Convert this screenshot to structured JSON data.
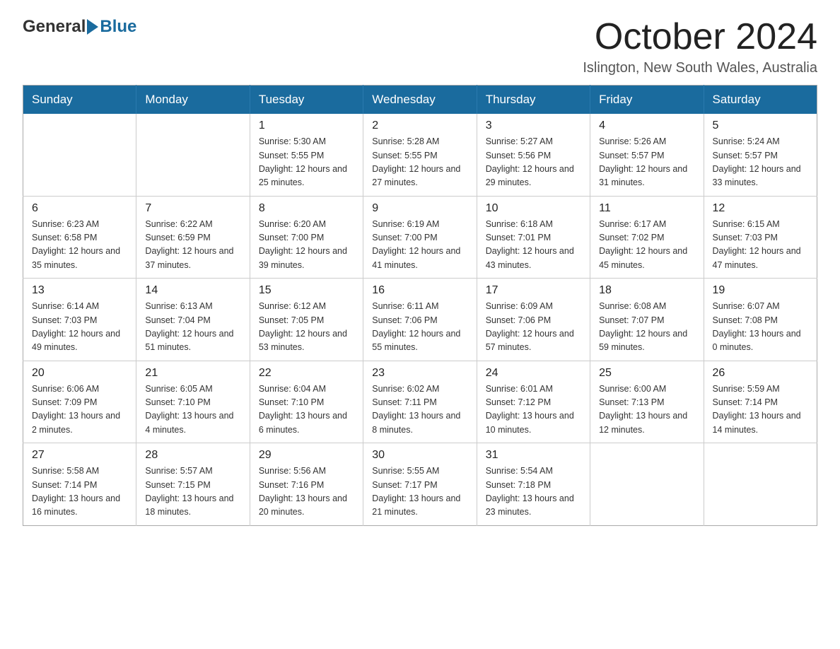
{
  "header": {
    "month_title": "October 2024",
    "location": "Islington, New South Wales, Australia",
    "logo_general": "General",
    "logo_blue": "Blue"
  },
  "calendar": {
    "days_of_week": [
      "Sunday",
      "Monday",
      "Tuesday",
      "Wednesday",
      "Thursday",
      "Friday",
      "Saturday"
    ],
    "weeks": [
      [
        {
          "day": "",
          "info": ""
        },
        {
          "day": "",
          "info": ""
        },
        {
          "day": "1",
          "info": "Sunrise: 5:30 AM\nSunset: 5:55 PM\nDaylight: 12 hours\nand 25 minutes."
        },
        {
          "day": "2",
          "info": "Sunrise: 5:28 AM\nSunset: 5:55 PM\nDaylight: 12 hours\nand 27 minutes."
        },
        {
          "day": "3",
          "info": "Sunrise: 5:27 AM\nSunset: 5:56 PM\nDaylight: 12 hours\nand 29 minutes."
        },
        {
          "day": "4",
          "info": "Sunrise: 5:26 AM\nSunset: 5:57 PM\nDaylight: 12 hours\nand 31 minutes."
        },
        {
          "day": "5",
          "info": "Sunrise: 5:24 AM\nSunset: 5:57 PM\nDaylight: 12 hours\nand 33 minutes."
        }
      ],
      [
        {
          "day": "6",
          "info": "Sunrise: 6:23 AM\nSunset: 6:58 PM\nDaylight: 12 hours\nand 35 minutes."
        },
        {
          "day": "7",
          "info": "Sunrise: 6:22 AM\nSunset: 6:59 PM\nDaylight: 12 hours\nand 37 minutes."
        },
        {
          "day": "8",
          "info": "Sunrise: 6:20 AM\nSunset: 7:00 PM\nDaylight: 12 hours\nand 39 minutes."
        },
        {
          "day": "9",
          "info": "Sunrise: 6:19 AM\nSunset: 7:00 PM\nDaylight: 12 hours\nand 41 minutes."
        },
        {
          "day": "10",
          "info": "Sunrise: 6:18 AM\nSunset: 7:01 PM\nDaylight: 12 hours\nand 43 minutes."
        },
        {
          "day": "11",
          "info": "Sunrise: 6:17 AM\nSunset: 7:02 PM\nDaylight: 12 hours\nand 45 minutes."
        },
        {
          "day": "12",
          "info": "Sunrise: 6:15 AM\nSunset: 7:03 PM\nDaylight: 12 hours\nand 47 minutes."
        }
      ],
      [
        {
          "day": "13",
          "info": "Sunrise: 6:14 AM\nSunset: 7:03 PM\nDaylight: 12 hours\nand 49 minutes."
        },
        {
          "day": "14",
          "info": "Sunrise: 6:13 AM\nSunset: 7:04 PM\nDaylight: 12 hours\nand 51 minutes."
        },
        {
          "day": "15",
          "info": "Sunrise: 6:12 AM\nSunset: 7:05 PM\nDaylight: 12 hours\nand 53 minutes."
        },
        {
          "day": "16",
          "info": "Sunrise: 6:11 AM\nSunset: 7:06 PM\nDaylight: 12 hours\nand 55 minutes."
        },
        {
          "day": "17",
          "info": "Sunrise: 6:09 AM\nSunset: 7:06 PM\nDaylight: 12 hours\nand 57 minutes."
        },
        {
          "day": "18",
          "info": "Sunrise: 6:08 AM\nSunset: 7:07 PM\nDaylight: 12 hours\nand 59 minutes."
        },
        {
          "day": "19",
          "info": "Sunrise: 6:07 AM\nSunset: 7:08 PM\nDaylight: 13 hours\nand 0 minutes."
        }
      ],
      [
        {
          "day": "20",
          "info": "Sunrise: 6:06 AM\nSunset: 7:09 PM\nDaylight: 13 hours\nand 2 minutes."
        },
        {
          "day": "21",
          "info": "Sunrise: 6:05 AM\nSunset: 7:10 PM\nDaylight: 13 hours\nand 4 minutes."
        },
        {
          "day": "22",
          "info": "Sunrise: 6:04 AM\nSunset: 7:10 PM\nDaylight: 13 hours\nand 6 minutes."
        },
        {
          "day": "23",
          "info": "Sunrise: 6:02 AM\nSunset: 7:11 PM\nDaylight: 13 hours\nand 8 minutes."
        },
        {
          "day": "24",
          "info": "Sunrise: 6:01 AM\nSunset: 7:12 PM\nDaylight: 13 hours\nand 10 minutes."
        },
        {
          "day": "25",
          "info": "Sunrise: 6:00 AM\nSunset: 7:13 PM\nDaylight: 13 hours\nand 12 minutes."
        },
        {
          "day": "26",
          "info": "Sunrise: 5:59 AM\nSunset: 7:14 PM\nDaylight: 13 hours\nand 14 minutes."
        }
      ],
      [
        {
          "day": "27",
          "info": "Sunrise: 5:58 AM\nSunset: 7:14 PM\nDaylight: 13 hours\nand 16 minutes."
        },
        {
          "day": "28",
          "info": "Sunrise: 5:57 AM\nSunset: 7:15 PM\nDaylight: 13 hours\nand 18 minutes."
        },
        {
          "day": "29",
          "info": "Sunrise: 5:56 AM\nSunset: 7:16 PM\nDaylight: 13 hours\nand 20 minutes."
        },
        {
          "day": "30",
          "info": "Sunrise: 5:55 AM\nSunset: 7:17 PM\nDaylight: 13 hours\nand 21 minutes."
        },
        {
          "day": "31",
          "info": "Sunrise: 5:54 AM\nSunset: 7:18 PM\nDaylight: 13 hours\nand 23 minutes."
        },
        {
          "day": "",
          "info": ""
        },
        {
          "day": "",
          "info": ""
        }
      ]
    ]
  }
}
